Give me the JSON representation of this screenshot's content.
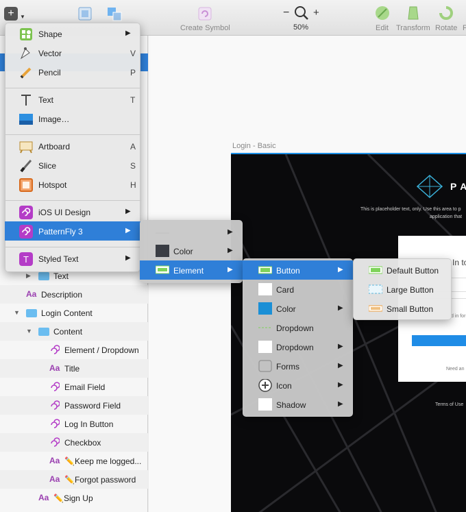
{
  "toolbar": {
    "create_symbol": "Create Symbol",
    "zoom_minus": "−",
    "zoom_plus": "+",
    "zoom_level": "50%",
    "edit": "Edit",
    "transform": "Transform",
    "rotate": "Rotate",
    "flatten_partial": "F"
  },
  "layers": [
    {
      "label": "Text",
      "type": "folder",
      "indent": 2,
      "twisty": "collapsed"
    },
    {
      "label": "Description",
      "type": "text",
      "indent": 1,
      "twisty": ""
    },
    {
      "label": "Login Content",
      "type": "folder",
      "indent": 1,
      "twisty": "expanded"
    },
    {
      "label": "Content",
      "type": "folder",
      "indent": 2,
      "twisty": "expanded"
    },
    {
      "label": "Element / Dropdown",
      "type": "symbol",
      "indent": 3,
      "twisty": ""
    },
    {
      "label": "Title",
      "type": "text",
      "indent": 3,
      "twisty": ""
    },
    {
      "label": "Email Field",
      "type": "symbol",
      "indent": 3,
      "twisty": ""
    },
    {
      "label": "Password Field",
      "type": "symbol",
      "indent": 3,
      "twisty": ""
    },
    {
      "label": "Log In Button",
      "type": "symbol",
      "indent": 3,
      "twisty": ""
    },
    {
      "label": "Checkbox",
      "type": "symbol",
      "indent": 3,
      "twisty": ""
    },
    {
      "label": "✏️Keep me logged...",
      "type": "text",
      "indent": 3,
      "twisty": ""
    },
    {
      "label": "✏️Forgot password",
      "type": "text",
      "indent": 3,
      "twisty": ""
    },
    {
      "label": "✏️Sign Up",
      "type": "text",
      "indent": 2,
      "twisty": ""
    }
  ],
  "canvas": {
    "artboard_title": "Login - Basic",
    "brand": "PA",
    "placeholder_line1": "This is placeholder text, only. Use this area to p",
    "placeholder_line2": "application that",
    "login_title_partial": "In to",
    "remember_partial": "d in for",
    "need_partial": "Need an",
    "terms": "Terms of Use"
  },
  "insert_menu": {
    "items": [
      {
        "label": "Shape",
        "shortcut": "",
        "submenu": true
      },
      {
        "label": "Vector",
        "shortcut": "V",
        "submenu": false
      },
      {
        "label": "Pencil",
        "shortcut": "P",
        "submenu": false
      },
      {
        "label": "Text",
        "shortcut": "T",
        "submenu": false
      },
      {
        "label": "Image…",
        "shortcut": "",
        "submenu": false
      },
      {
        "label": "Artboard",
        "shortcut": "A",
        "submenu": false
      },
      {
        "label": "Slice",
        "shortcut": "S",
        "submenu": false
      },
      {
        "label": "Hotspot",
        "shortcut": "H",
        "submenu": false
      },
      {
        "label": "iOS UI Design",
        "shortcut": "",
        "submenu": true
      },
      {
        "label": "PatternFly 3",
        "shortcut": "",
        "submenu": true
      },
      {
        "label": "Styled Text",
        "shortcut": "",
        "submenu": true
      }
    ]
  },
  "patternfly_menu": {
    "items": [
      {
        "label": "",
        "submenu": true
      },
      {
        "label": "Color",
        "submenu": true
      },
      {
        "label": "Element",
        "submenu": true
      }
    ]
  },
  "element_menu": {
    "items": [
      {
        "label": "Button",
        "submenu": true
      },
      {
        "label": "Card",
        "submenu": false
      },
      {
        "label": "Color",
        "submenu": true
      },
      {
        "label": "Dropdown",
        "submenu": false
      },
      {
        "label": "Dropdown",
        "submenu": true
      },
      {
        "label": "Forms",
        "submenu": true
      },
      {
        "label": "Icon",
        "submenu": true
      },
      {
        "label": "Shadow",
        "submenu": true
      }
    ]
  },
  "button_menu": {
    "items": [
      {
        "label": "Default Button"
      },
      {
        "label": "Large Button"
      },
      {
        "label": "Small Button"
      }
    ]
  },
  "colors": {
    "accent": "#2f7fd8",
    "symbol_purple": "#b43cc7",
    "folder_blue": "#6bbdf0",
    "artboard_bg": "#0a0a0c",
    "color_swatch_blue": "#1a8fd6",
    "color_swatch_dark": "#3a3d44"
  }
}
